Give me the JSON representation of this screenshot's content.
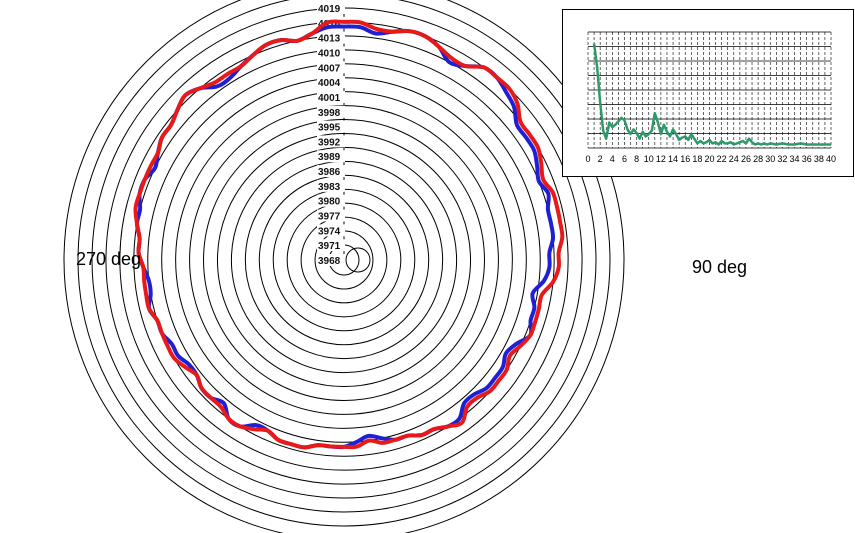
{
  "chart_data": [
    {
      "type": "polar-line",
      "radial_ticks": [
        "4019",
        "4016",
        "4013",
        "4010",
        "4007",
        "4004",
        "4001",
        "3998",
        "3995",
        "3992",
        "3989",
        "3986",
        "3983",
        "3980",
        "3977",
        "3974",
        "3971",
        "3968"
      ],
      "rlim": [
        3968,
        4019
      ],
      "angle_labels": {
        "left": "270 deg",
        "right": "90 deg"
      },
      "grid": true,
      "series": [
        {
          "color": "#1f1fd6",
          "values": [
            4015,
            4015,
            4014,
            4015,
            4016,
            4016,
            4015,
            4013,
            4014,
            4016,
            4016,
            4015,
            4014,
            4012,
            4012,
            4012,
            4011,
            4010,
            4011,
            4010,
            4010,
            4010,
            4009,
            4009,
            4008,
            4006,
            4007,
            4007,
            4008,
            4006,
            4005,
            4006,
            4006,
            4006,
            4005,
            4005,
            4007,
            4007,
            4006,
            4006,
            4005,
            4005,
            4004,
            4003,
            4004,
            4005,
            4005,
            4005,
            4006,
            4006,
            4006,
            4005,
            4005,
            4007,
            4007,
            4005,
            4006,
            4006,
            4005,
            4005,
            4006,
            4006,
            4007,
            4007,
            4008,
            4007,
            4007,
            4008,
            4009,
            4009,
            4010,
            4010,
            4011,
            4011,
            4010,
            4011,
            4012,
            4012,
            4013,
            4014,
            4013,
            4011,
            4011,
            4012,
            4013,
            4014,
            4014,
            4013,
            4014,
            4015
          ]
        },
        {
          "color": "#e81919",
          "values": [
            4016,
            4016,
            4015,
            4015,
            4016,
            4016,
            4015,
            4014,
            4014,
            4016,
            4016,
            4016,
            4015,
            4013,
            4013,
            4013,
            4012,
            4011,
            4012,
            4012,
            4012,
            4012,
            4011,
            4011,
            4010,
            4008,
            4008,
            4008,
            4008,
            4007,
            4006,
            4007,
            4007,
            4007,
            4006,
            4006,
            4008,
            4007,
            4006,
            4006,
            4005,
            4005,
            4005,
            4004,
            4005,
            4005,
            4005,
            4005,
            4006,
            4006,
            4006,
            4005,
            4006,
            4007,
            4007,
            4006,
            4006,
            4006,
            4005,
            4006,
            4007,
            4007,
            4007,
            4007,
            4008,
            4008,
            4008,
            4008,
            4009,
            4009,
            4010,
            4011,
            4011,
            4011,
            4011,
            4011,
            4012,
            4012,
            4013,
            4014,
            4013,
            4012,
            4012,
            4012,
            4013,
            4014,
            4014,
            4013,
            4014,
            4016
          ]
        }
      ]
    },
    {
      "type": "line",
      "x_ticks": [
        "0",
        "2",
        "4",
        "6",
        "8",
        "10",
        "12",
        "14",
        "16",
        "18",
        "20",
        "22",
        "24",
        "26",
        "28",
        "30",
        "32",
        "34",
        "36",
        "38",
        "40"
      ],
      "xlim": [
        0,
        40
      ],
      "ylim": [
        0,
        10
      ],
      "grid": true,
      "series": [
        {
          "color": "#2e9a6a",
          "x": [
            1,
            1.5,
            2,
            2.5,
            3,
            3.5,
            4,
            4.5,
            5,
            5.5,
            6,
            6.5,
            7,
            7.5,
            8,
            8.5,
            9,
            9.5,
            10,
            10.5,
            11,
            11.5,
            12,
            12.5,
            13,
            13.5,
            14,
            14.5,
            15,
            15.5,
            16,
            16.5,
            17,
            17.5,
            18,
            18.5,
            19,
            19.5,
            20,
            20.5,
            21,
            21.5,
            22,
            22.5,
            23,
            23.5,
            24,
            24.5,
            25,
            25.5,
            26,
            26.5,
            27,
            27.5,
            28,
            28.5,
            29,
            29.5,
            30,
            31,
            32,
            33,
            34,
            35,
            36,
            37,
            38,
            39,
            40
          ],
          "values": [
            9.0,
            7.0,
            4.0,
            1.5,
            0.8,
            2.2,
            1.8,
            2.0,
            2.3,
            2.6,
            2.4,
            1.6,
            1.2,
            1.6,
            1.3,
            0.8,
            1.4,
            1.0,
            1.2,
            1.5,
            3.0,
            2.2,
            1.2,
            2.0,
            1.4,
            1.0,
            1.6,
            1.2,
            0.7,
            0.9,
            1.0,
            0.7,
            1.2,
            0.8,
            0.4,
            0.6,
            0.4,
            0.5,
            0.7,
            0.4,
            0.5,
            0.3,
            0.6,
            0.4,
            0.4,
            0.5,
            0.3,
            0.4,
            0.5,
            0.6,
            0.4,
            0.8,
            0.5,
            0.3,
            0.4,
            0.3,
            0.4,
            0.3,
            0.4,
            0.3,
            0.4,
            0.3,
            0.3,
            0.4,
            0.3,
            0.3,
            0.3,
            0.3,
            0.3
          ]
        }
      ]
    }
  ]
}
